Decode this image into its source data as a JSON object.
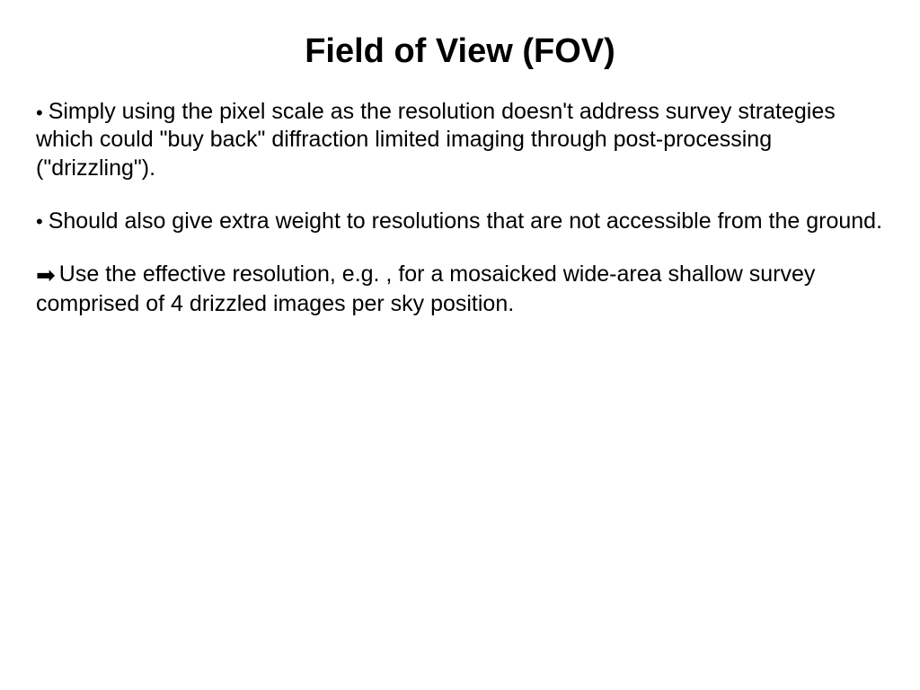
{
  "title": "Field of View (FOV)",
  "bullets": [
    {
      "marker": "•",
      "text": "Simply using the pixel scale as the resolution doesn't address survey strategies which could \"buy back\" diffraction limited imaging through post-processing (\"drizzling\")."
    },
    {
      "marker": "•",
      "text": "Should also give extra weight to resolutions that are not accessible from the ground."
    },
    {
      "marker": "➡",
      "text": "Use the effective resolution, e.g. , for a mosaicked wide-area shallow survey comprised of 4 drizzled images per sky position."
    }
  ]
}
